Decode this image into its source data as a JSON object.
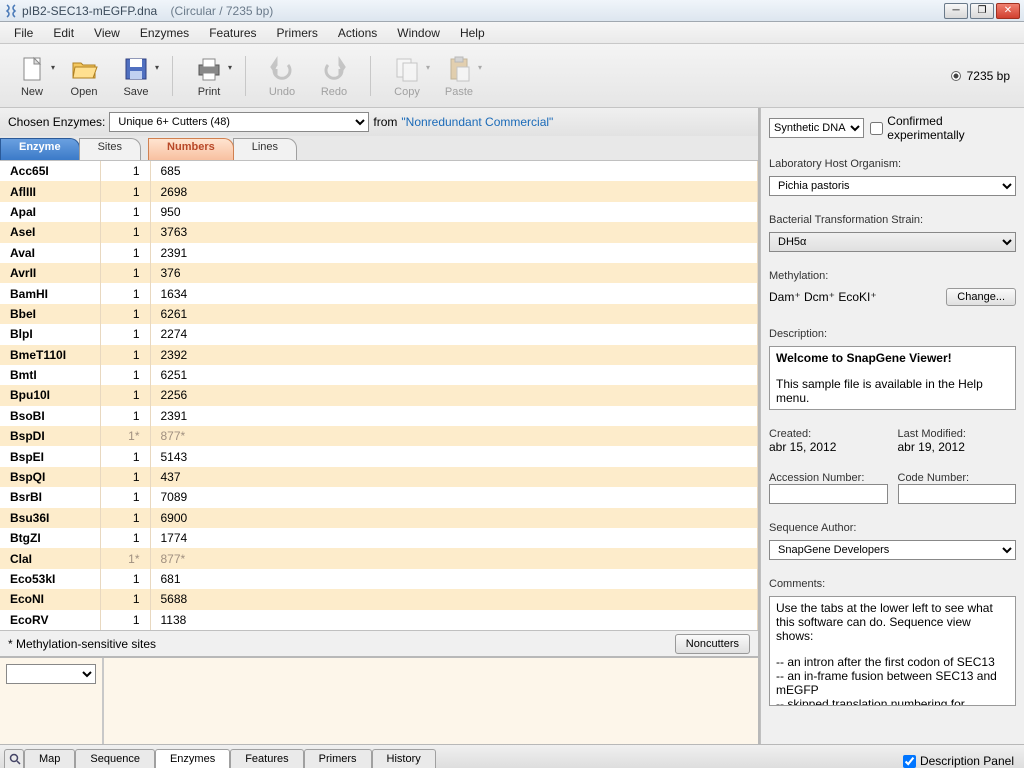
{
  "title": {
    "name": "pIB2-SEC13-mEGFP.dna",
    "suffix": "(Circular / 7235 bp)"
  },
  "menu": [
    "File",
    "Edit",
    "View",
    "Enzymes",
    "Features",
    "Primers",
    "Actions",
    "Window",
    "Help"
  ],
  "toolbar": {
    "new": "New",
    "open": "Open",
    "save": "Save",
    "print": "Print",
    "undo": "Undo",
    "redo": "Redo",
    "copy": "Copy",
    "paste": "Paste",
    "bp": "7235 bp"
  },
  "chosen": {
    "label": "Chosen Enzymes:",
    "value": "Unique 6+ Cutters  (48)",
    "from": "from",
    "source": "\"Nonredundant Commercial\""
  },
  "leftTabs": {
    "enzyme": "Enzyme",
    "sites": "Sites",
    "numbers": "Numbers",
    "lines": "Lines"
  },
  "enzymes": [
    {
      "name": "Acc65I",
      "sites": "1",
      "num": "685"
    },
    {
      "name": "AflIII",
      "sites": "1",
      "num": "2698"
    },
    {
      "name": "ApaI",
      "sites": "1",
      "num": "950"
    },
    {
      "name": "AseI",
      "sites": "1",
      "num": "3763"
    },
    {
      "name": "AvaI",
      "sites": "1",
      "num": "2391"
    },
    {
      "name": "AvrII",
      "sites": "1",
      "num": "376"
    },
    {
      "name": "BamHI",
      "sites": "1",
      "num": "1634"
    },
    {
      "name": "BbeI",
      "sites": "1",
      "num": "6261"
    },
    {
      "name": "BlpI",
      "sites": "1",
      "num": "2274"
    },
    {
      "name": "BmeT110I",
      "sites": "1",
      "num": "2392"
    },
    {
      "name": "BmtI",
      "sites": "1",
      "num": "6251"
    },
    {
      "name": "Bpu10I",
      "sites": "1",
      "num": "2256"
    },
    {
      "name": "BsoBI",
      "sites": "1",
      "num": "2391"
    },
    {
      "name": "BspDI",
      "sites": "1*",
      "num": "877*",
      "meth": true
    },
    {
      "name": "BspEI",
      "sites": "1",
      "num": "5143"
    },
    {
      "name": "BspQI",
      "sites": "1",
      "num": "437"
    },
    {
      "name": "BsrBI",
      "sites": "1",
      "num": "7089"
    },
    {
      "name": "Bsu36I",
      "sites": "1",
      "num": "6900"
    },
    {
      "name": "BtgZI",
      "sites": "1",
      "num": "1774"
    },
    {
      "name": "ClaI",
      "sites": "1*",
      "num": "877*",
      "meth": true
    },
    {
      "name": "Eco53kI",
      "sites": "1",
      "num": "681"
    },
    {
      "name": "EcoNI",
      "sites": "1",
      "num": "5688"
    },
    {
      "name": "EcoRV",
      "sites": "1",
      "num": "1138"
    }
  ],
  "footer": {
    "note": "* Methylation-sensitive sites",
    "noncutters": "Noncutters"
  },
  "right": {
    "synthetic": "Synthetic DNA",
    "confirmed": "Confirmed experimentally",
    "labHostLabel": "Laboratory Host Organism:",
    "labHost": "Pichia pastoris",
    "strainLabel": "Bacterial Transformation Strain:",
    "strain": "DH5α",
    "methLabel": "Methylation:",
    "methValue": "Dam⁺  Dcm⁺  EcoKI⁺",
    "change": "Change...",
    "descLabel": "Description:",
    "descTitle": "Welcome to SnapGene Viewer!",
    "descBody": "This sample file is available in the Help menu.",
    "createdLabel": "Created:",
    "created": "abr 15, 2012",
    "modifiedLabel": "Last Modified:",
    "modified": "abr 19, 2012",
    "accLabel": "Accession Number:",
    "codeLabel": "Code Number:",
    "authorLabel": "Sequence Author:",
    "author": "SnapGene Developers",
    "commentsLabel": "Comments:",
    "comment1": "Use the tabs at the lower left to see what this software can do. Sequence view shows:",
    "comment2": "-- an intron after the first codon of SEC13",
    "comment3": "-- an in-frame fusion between SEC13 and mEGFP",
    "comment4": "-- skipped translation numbering for"
  },
  "bottomTabs": {
    "map": "Map",
    "sequence": "Sequence",
    "enzymes": "Enzymes",
    "features": "Features",
    "primers": "Primers",
    "history": "History",
    "descPanel": "Description Panel"
  }
}
